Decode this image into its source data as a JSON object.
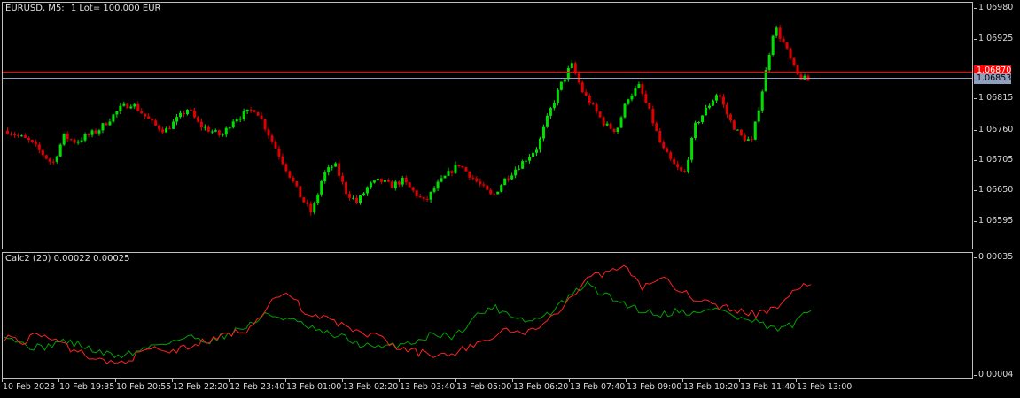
{
  "chart_header": {
    "symbol": "EURUSD, M5:",
    "lot_info": "1 Lot= 100,000 EUR"
  },
  "indicator_header": {
    "label": "Calc2 (20) 0.00022 0.00025"
  },
  "price_axis": [
    "1.06980",
    "1.06925",
    "1.06870",
    "1.06815",
    "1.06760",
    "1.06705",
    "1.06650",
    "1.06595"
  ],
  "price_lines": {
    "ask_price": "1.06870",
    "bid_price": "1.06853"
  },
  "indicator_axis": [
    "0.00035",
    "0.00004"
  ],
  "time_axis": [
    "10 Feb 2023",
    "10 Feb 19:35",
    "10 Feb 20:55",
    "12 Feb 22:20",
    "12 Feb 23:40",
    "13 Feb 01:00",
    "13 Feb 02:20",
    "13 Feb 03:40",
    "13 Feb 05:00",
    "13 Feb 06:20",
    "13 Feb 07:40",
    "13 Feb 09:00",
    "13 Feb 10:20",
    "13 Feb 11:40",
    "13 Feb 13:00"
  ],
  "colors": {
    "bull": "#00e000",
    "bear": "#e00000",
    "ask_line": "#ff0000",
    "bid_line": "#8e9fbf",
    "indicator_green": "#00a000",
    "indicator_red": "#ff2020"
  },
  "chart_data": {
    "type": "candlestick",
    "close_path": [
      1.0676,
      1.0675,
      1.0674,
      1.0672,
      1.067,
      1.0675,
      1.0674,
      1.0675,
      1.0676,
      1.0678,
      1.068,
      1.0681,
      1.0679,
      1.0677,
      1.0676,
      1.0678,
      1.068,
      1.0677,
      1.0676,
      1.0675,
      1.0678,
      1.0679,
      1.068,
      1.0676,
      1.0672,
      1.0668,
      1.0664,
      1.0661,
      1.0668,
      1.067,
      1.0665,
      1.0663,
      1.0666,
      1.0667,
      1.0666,
      1.0667,
      1.0665,
      1.0663,
      1.0666,
      1.0668,
      1.067,
      1.0668,
      1.0666,
      1.0664,
      1.0667,
      1.0669,
      1.0671,
      1.0673,
      1.0679,
      1.0684,
      1.0688,
      1.0683,
      1.068,
      1.0677,
      1.0676,
      1.0682,
      1.0684,
      1.0679,
      1.0673,
      1.067,
      1.0668,
      1.0677,
      1.068,
      1.0683,
      1.0678,
      1.0675,
      1.0674,
      1.0684,
      1.0695,
      1.0691,
      1.0686,
      1.0685
    ],
    "indicator_series": [
      {
        "color": "green",
        "values": [
          0.00015,
          0.00012,
          0.00011,
          0.00013,
          0.00012,
          0.0001,
          9e-05,
          0.0001,
          0.00012,
          0.00013,
          0.00014,
          0.00013,
          0.00015,
          0.00017,
          0.0002,
          0.00019,
          0.00017,
          0.00015,
          0.00014,
          0.00012,
          0.00011,
          0.00012,
          0.00013,
          0.00015,
          0.00014,
          0.00019,
          0.00022,
          0.0002,
          0.00018,
          0.0002,
          0.00024,
          0.00028,
          0.00025,
          0.00023,
          0.00021,
          0.0002,
          0.00021,
          0.0002,
          0.00022,
          0.00019,
          0.00018,
          0.00016,
          0.00017,
          0.00021
        ]
      },
      {
        "color": "red",
        "values": [
          0.00014,
          0.00013,
          0.00015,
          0.00012,
          0.0001,
          8e-05,
          7e-05,
          9e-05,
          0.00011,
          0.0001,
          0.00012,
          0.00013,
          0.00015,
          0.00016,
          0.00022,
          0.00026,
          0.00021,
          0.00019,
          0.00017,
          0.00015,
          0.00014,
          0.00011,
          0.0001,
          9e-05,
          0.0001,
          0.00012,
          0.00014,
          0.00016,
          0.00015,
          0.00019,
          0.00023,
          0.00029,
          0.00031,
          0.00033,
          0.00027,
          0.0003,
          0.00026,
          0.00024,
          0.00022,
          0.00021,
          0.0002,
          0.00021,
          0.00026,
          0.00028
        ]
      }
    ]
  }
}
